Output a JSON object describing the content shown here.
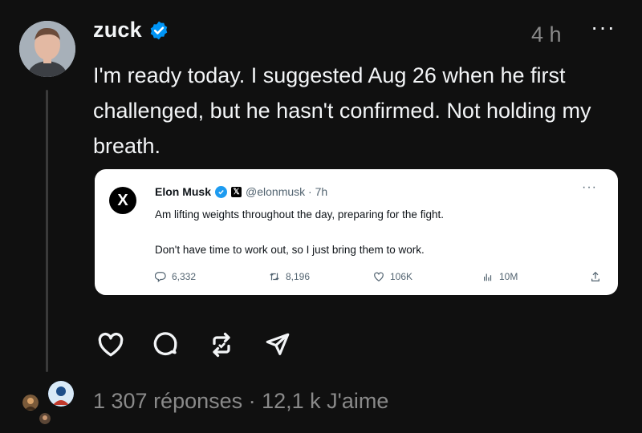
{
  "post": {
    "username": "zuck",
    "timestamp": "4 h",
    "more_label": "···",
    "text": "I'm ready today. I suggested Aug 26 when he first challenged, but he hasn't confirmed. Not holding my breath.",
    "stats": "1 307 réponses · 12,1 k J'aime"
  },
  "quoted_tweet": {
    "avatar_letter": "X",
    "author": "Elon Musk",
    "handle_time": "@elonmusk · 7h",
    "line1": "Am lifting weights throughout the day, preparing for the fight.",
    "line2": "Don't have time to work out, so I just bring them to work.",
    "more_label": "···",
    "replies": "6,332",
    "retweets": "8,196",
    "likes": "106K",
    "views": "10M"
  },
  "icons": {
    "verified": "verified-badge-icon",
    "like": "heart-icon",
    "reply": "comment-icon",
    "repost": "repost-icon",
    "share": "send-icon"
  },
  "colors": {
    "background": "#101010",
    "text": "#f3f5f7",
    "muted": "#8a8a8a",
    "verified": "#0095f6",
    "card": "#ffffff",
    "twitter_blue": "#1d9bf0"
  }
}
